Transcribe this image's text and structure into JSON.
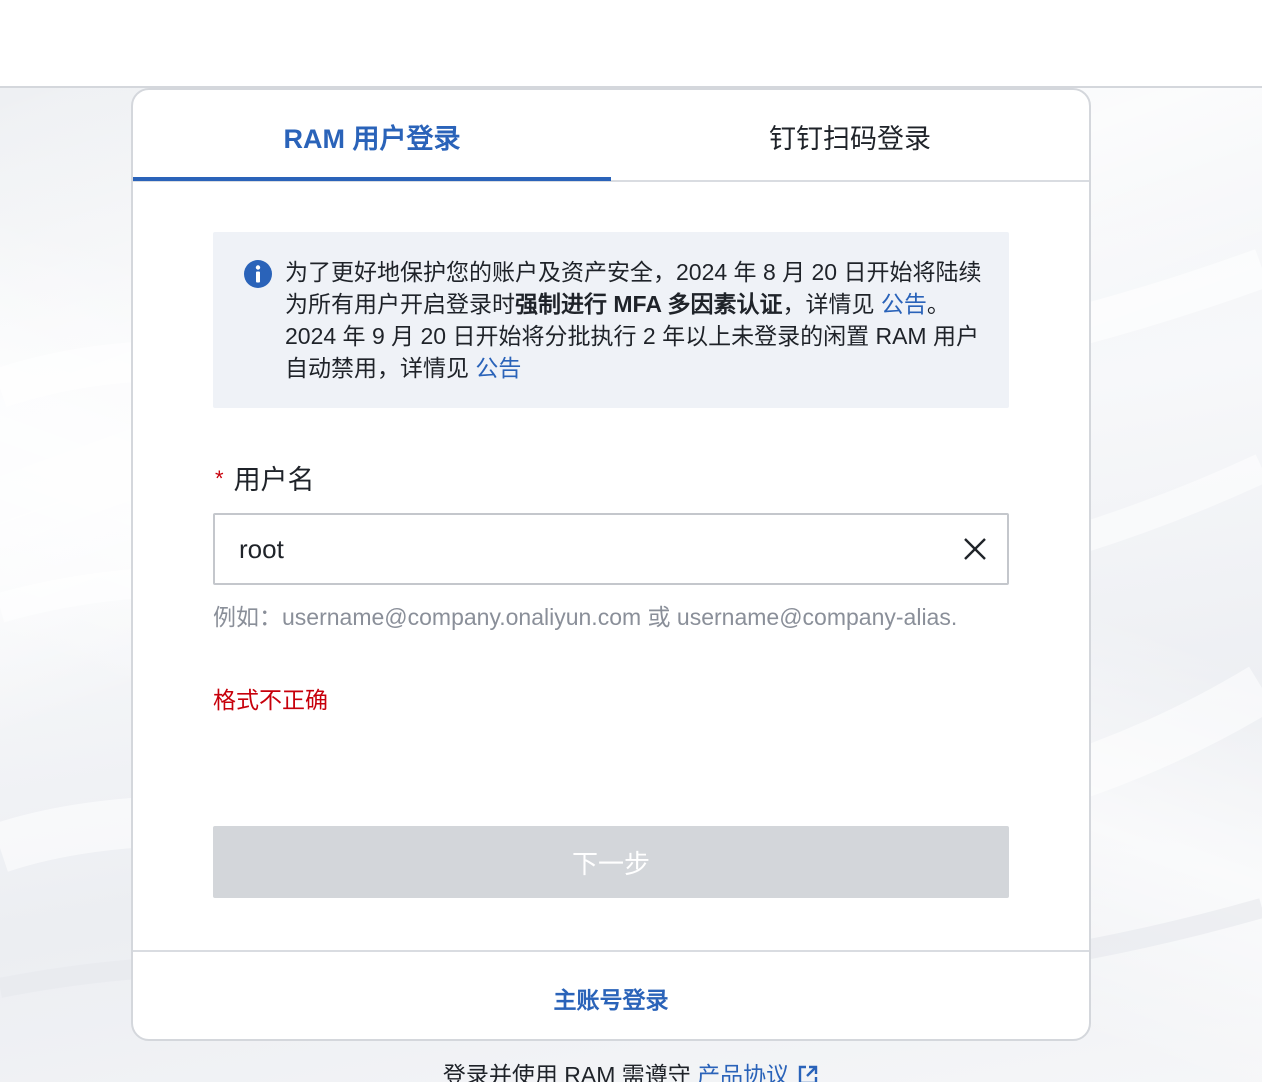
{
  "tabs": {
    "ram_login": "RAM 用户登录",
    "dingtalk_login": "钉钉扫码登录"
  },
  "notice": {
    "part1": "为了更好地保护您的账户及资产安全，2024 年 8 月 20 日开始将陆续为所有用户开启登录时",
    "bold": "强制进行 MFA 多因素认证",
    "part2": "，详情见 ",
    "link1": "公告",
    "part3": "。2024 年 9 月 20 日开始将分批执行 2 年以上未登录的闲置 RAM 用户自动禁用，详情见 ",
    "link2": "公告"
  },
  "username": {
    "required_mark": "*",
    "label": "用户名",
    "value": "root",
    "hint": "例如：username@company.onaliyun.com 或 username@company-alias.",
    "error": "格式不正确"
  },
  "next_button": "下一步",
  "footer": {
    "main_account_login": "主账号登录"
  },
  "agreement": {
    "text": "登录并使用 RAM 需遵守 ",
    "link": "产品协议"
  },
  "colors": {
    "accent": "#2a63b9",
    "error": "#c7000b",
    "disabled_button": "#d3d6da"
  }
}
